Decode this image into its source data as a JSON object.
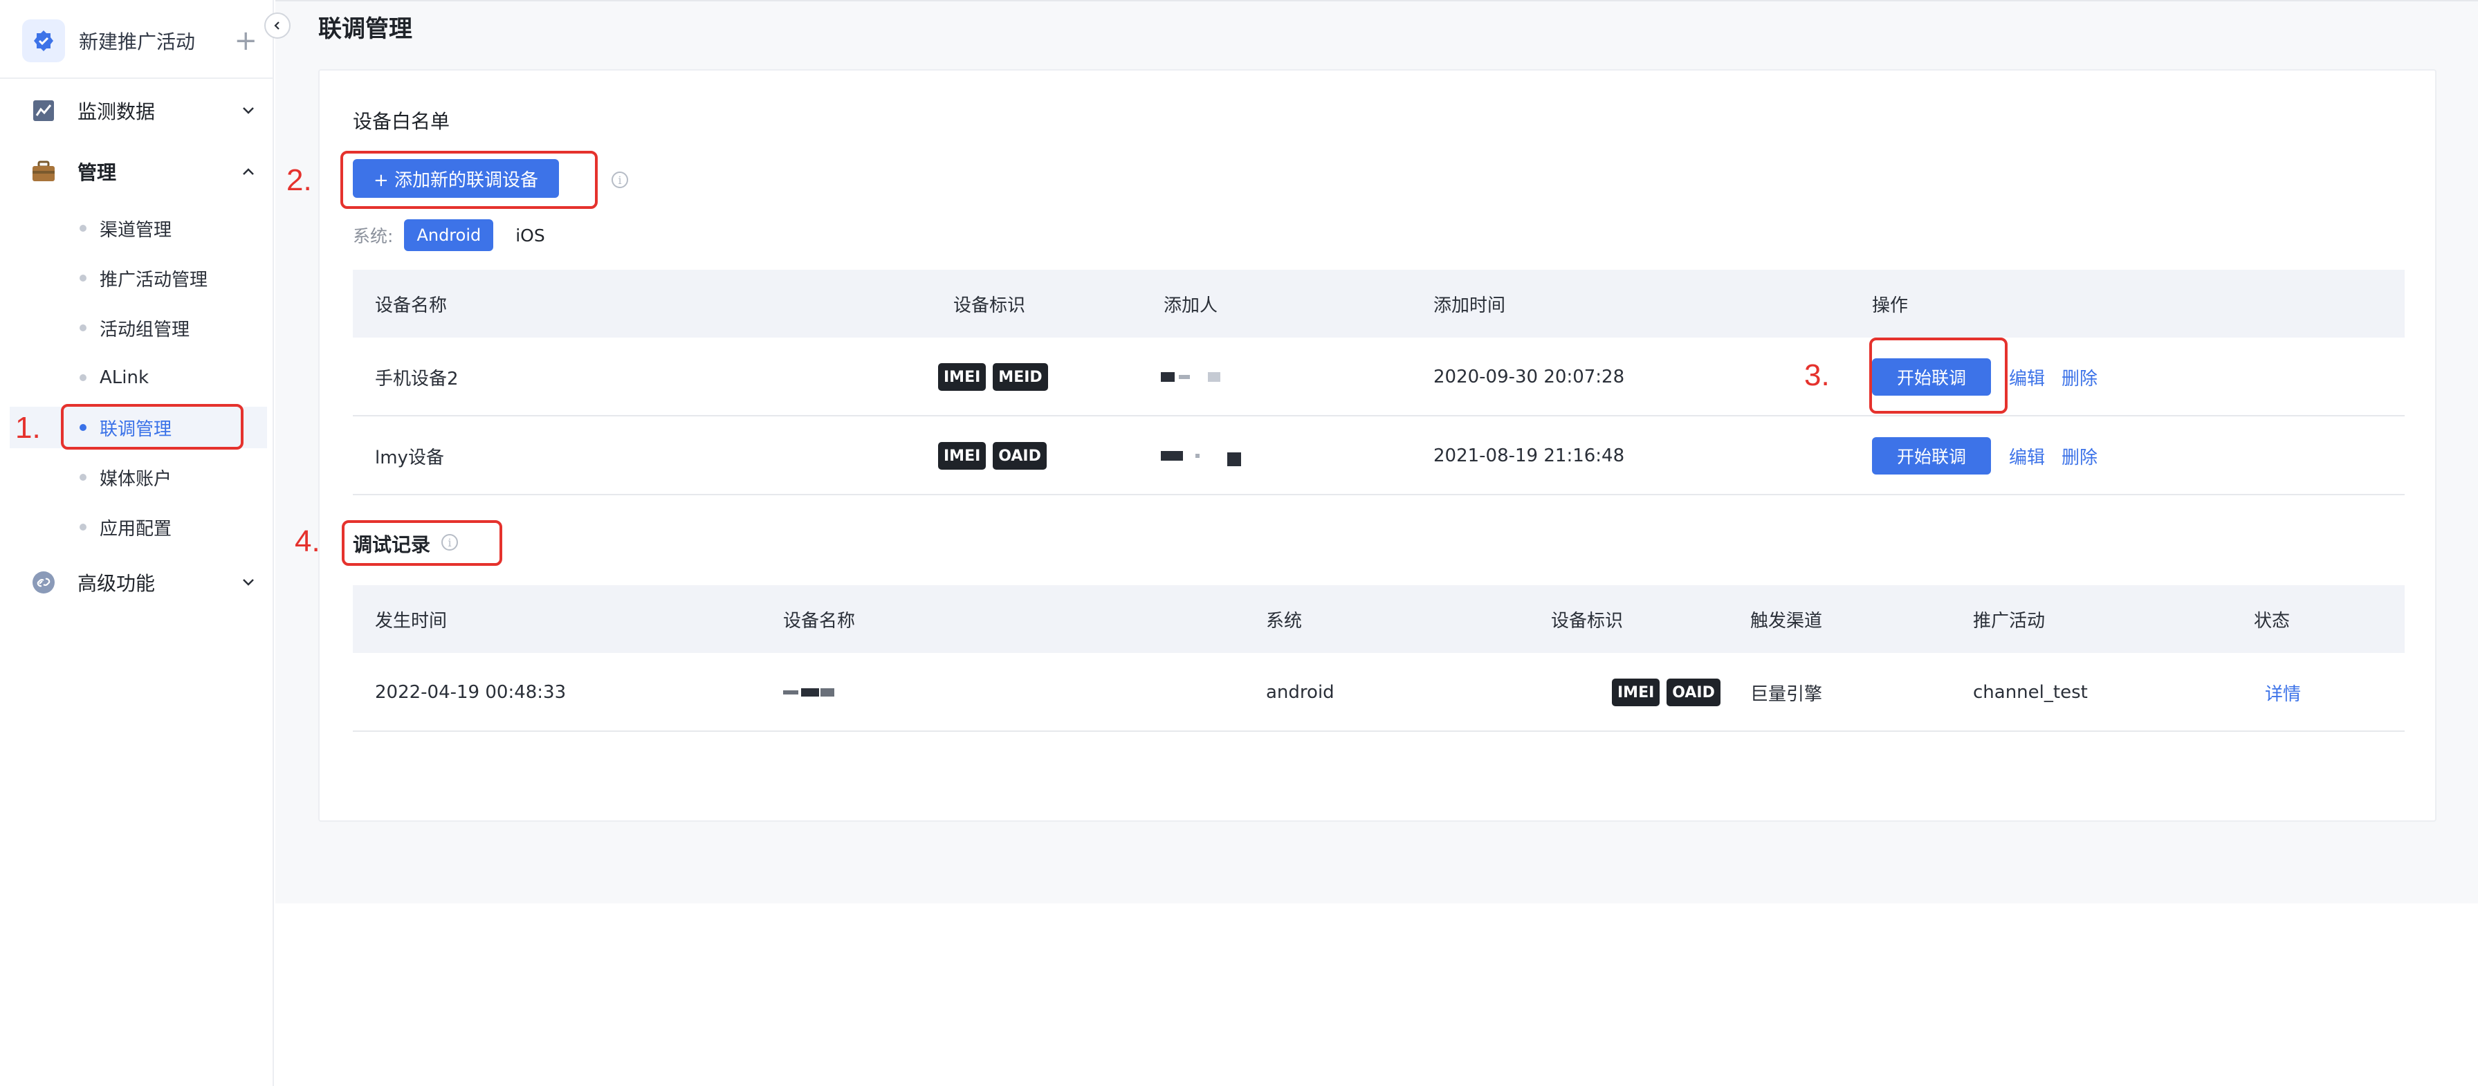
{
  "sidebar": {
    "brand_title": "新建推广活动",
    "brand_plus": "+",
    "groups": [
      {
        "label": "监测数据",
        "icon": "chart-icon"
      },
      {
        "label": "管理",
        "icon": "briefcase-icon"
      },
      {
        "label": "高级功能",
        "icon": "link-icon"
      }
    ],
    "items": [
      {
        "label": "渠道管理"
      },
      {
        "label": "推广活动管理"
      },
      {
        "label": "活动组管理"
      },
      {
        "label": "ALink"
      },
      {
        "label": "联调管理",
        "active": true
      },
      {
        "label": "媒体账户"
      },
      {
        "label": "应用配置"
      }
    ]
  },
  "page": {
    "title": "联调管理"
  },
  "whitelist": {
    "title": "设备白名单",
    "add_button": "+ 添加新的联调设备",
    "info_icon": "info-icon",
    "system_label": "系统:",
    "system_options": [
      "Android",
      "iOS"
    ],
    "selected_system": "Android",
    "columns": [
      "设备名称",
      "设备标识",
      "添加人",
      "添加时间",
      "操作"
    ],
    "rows": [
      {
        "name": "手机设备2",
        "tags": [
          "IMEI",
          "MEID"
        ],
        "time": "2020-09-30 20:07:28",
        "start": "开始联调",
        "edit": "编辑",
        "delete": "删除"
      },
      {
        "name": "lmy设备",
        "tags": [
          "IMEI",
          "OAID"
        ],
        "time": "2021-08-19 21:16:48",
        "start": "开始联调",
        "edit": "编辑",
        "delete": "删除"
      }
    ]
  },
  "debug_log": {
    "title": "调试记录",
    "columns": [
      "发生时间",
      "设备名称",
      "系统",
      "设备标识",
      "触发渠道",
      "推广活动",
      "状态"
    ],
    "rows": [
      {
        "time": "2022-04-19 00:48:33",
        "system": "android",
        "tags": [
          "IMEI",
          "OAID"
        ],
        "channel": "巨量引擎",
        "campaign": "channel_test",
        "status": "详情"
      }
    ]
  },
  "annotations": [
    "1.",
    "2.",
    "3.",
    "4."
  ],
  "colors": {
    "accent": "#3d73e8",
    "annotation": "#e5322d",
    "tag_bg": "#1f2329"
  }
}
